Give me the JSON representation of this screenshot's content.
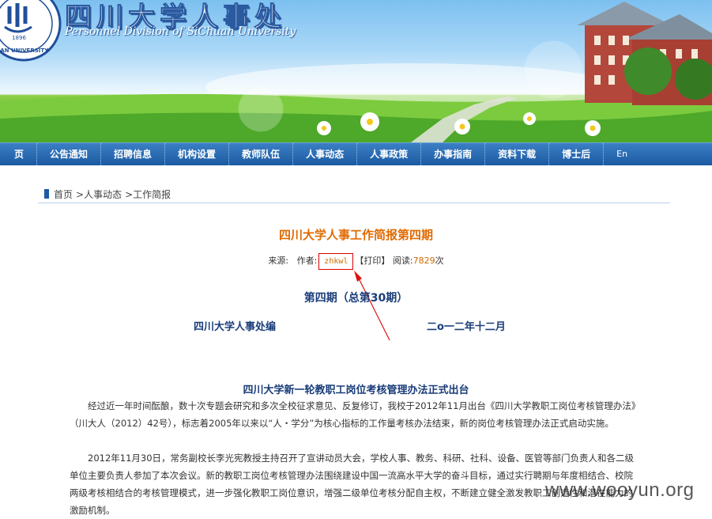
{
  "header": {
    "title": "四川大学人事处",
    "subtitle": "Personnel Division of SiChuan University",
    "logo_year": "1896",
    "logo_ring_text": "UAN UNIVERSITY"
  },
  "nav": {
    "items": [
      "页",
      "公告通知",
      "招聘信息",
      "机构设置",
      "教师队伍",
      "人事动态",
      "人事政策",
      "办事指南",
      "资料下载",
      "博士后",
      "En"
    ]
  },
  "breadcrumb": {
    "home": "首页",
    "level1": ">人事动态",
    "level2": ">工作简报"
  },
  "article": {
    "title": "四川大学人事工作简报第四期",
    "meta": {
      "source_label": "来源:",
      "author_label": "作者:",
      "author": "zhkwl",
      "print": "【打印】",
      "views_label": "阅读:",
      "views": "7829",
      "views_unit": "次"
    },
    "issue": "第四期（总第30期）",
    "publisher": "四川大学人事处编",
    "date": "二o一二年十二月",
    "section_title": "四川大学新一轮教职工岗位考核管理办法正式出台",
    "paragraphs": [
      "经过近一年时间酝酿，数十次专题会研究和多次全校征求意见、反复修订，我校于2012年11月出台《四川大学教职工岗位考核管理办法》（川大人（2012）42号），标志着2005年以来以“人・学分”为核心指标的工作量考核办法结束，新的岗位考核管理办法正式启动实施。",
      "2012年11月30日，常务副校长李光宪教授主持召开了宣讲动员大会，学校人事、教务、科研、社科、设备、医管等部门负责人和各二级单位主要负责人参加了本次会议。新的教职工岗位考核管理办法围绕建设中国一流高水平大学的奋斗目标，通过实行聘期与年度相结合、校院两级考核相结合的考核管理模式，进一步强化教职工岗位意识，增强二级单位考核分配自主权，不断建立健全激发教职工创造性和潜在能力的激励机制。"
    ]
  },
  "watermark": "www.wooyun.org",
  "colors": {
    "nav_bg": "#1c5aa2",
    "title_orange": "#e06a00",
    "heading_blue": "#1a3d7a",
    "highlight_red": "#dd0000"
  }
}
